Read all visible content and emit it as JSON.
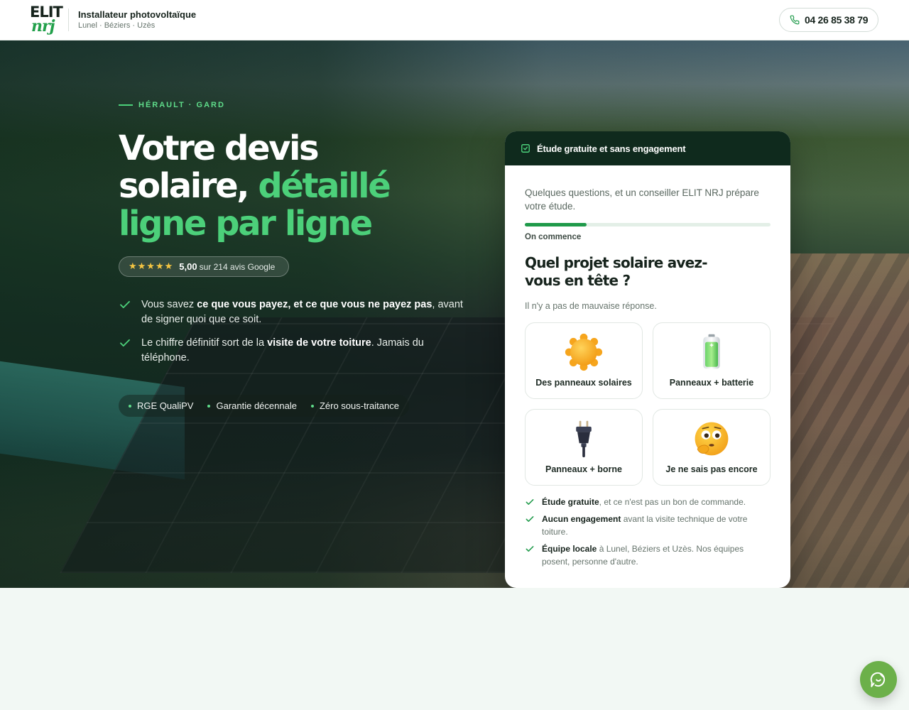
{
  "header": {
    "logo_line1": "ELIT",
    "logo_line2": "nrj",
    "title": "Installateur photovoltaïque",
    "subtitle": "Lunel · Béziers · Uzès",
    "phone": "04 26 85 38 79"
  },
  "hero": {
    "eyebrow": "HÉRAULT · GARD",
    "title_line1": "Votre devis",
    "title_line2_white": "solaire, ",
    "title_line2_green": "détaillé",
    "title_line3": "ligne par ligne",
    "rating": {
      "stars": "★★★★★",
      "score": "5,00",
      "count": "sur 214 avis Google"
    },
    "benefits": [
      {
        "pre": "Vous savez ",
        "bold": "ce que vous payez, et ce que vous ne payez pas",
        "post": ", avant de signer quoi que ce soit."
      },
      {
        "pre": "Le chiffre définitif sort de la ",
        "bold": "visite de votre toiture",
        "post": ". Jamais du téléphone."
      }
    ],
    "badges": [
      "RGE QualiPV",
      "Garantie décennale",
      "Zéro sous-traitance"
    ]
  },
  "card": {
    "header": "Étude gratuite et sans engagement",
    "intro": "Quelques questions, et un conseiller ELIT NRJ prépare votre étude.",
    "progress": 0.25,
    "step_label": "On commence",
    "question": "Quel projet solaire avez-vous en tête ?",
    "hint": "Il n'y a pas de mauvaise réponse.",
    "options": [
      {
        "label": "Des panneaux solaires",
        "icon": "sun-icon"
      },
      {
        "label": "Panneaux + batterie",
        "icon": "battery-icon"
      },
      {
        "label": "Panneaux + borne",
        "icon": "plug-icon"
      },
      {
        "label": "Je ne sais pas encore",
        "icon": "thinking-face-icon"
      }
    ],
    "assurances": [
      {
        "bold": "Étude gratuite",
        "text": ", et ce n'est pas un bon de commande."
      },
      {
        "bold": "Aucun engagement",
        "text": " avant la visite technique de votre toiture."
      },
      {
        "bold": "Équipe locale",
        "text": " à Lunel, Béziers et Uzès. Nos équipes posent, personne d'autre."
      }
    ]
  },
  "colors": {
    "accent": "#4cd07a",
    "dark_green": "#0f2a1d",
    "progress": "#1f9a4a",
    "chat": "#6cb04a"
  }
}
